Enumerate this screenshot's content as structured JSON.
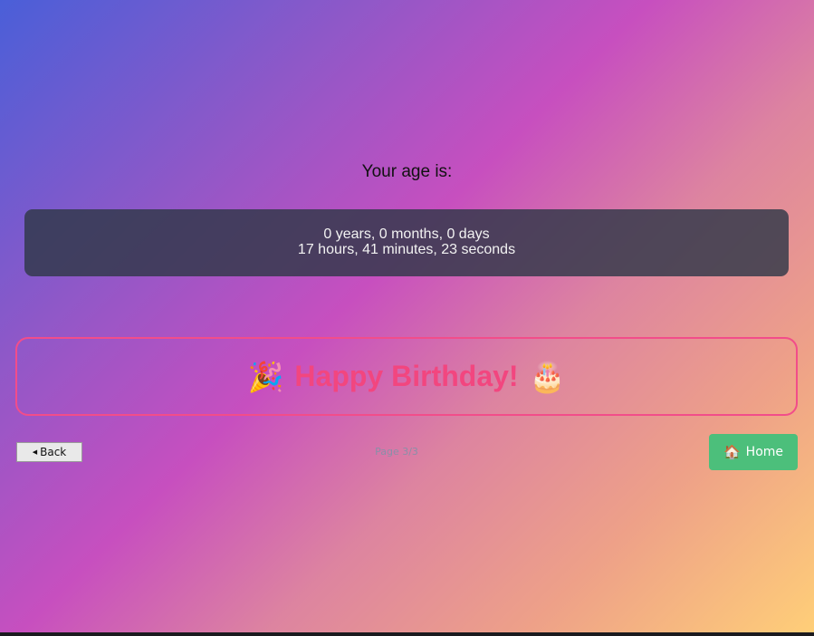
{
  "age": {
    "title": "Your age is:",
    "line1": "0 years, 0 months, 0 days",
    "line2": "17 hours, 41 minutes, 23 seconds"
  },
  "birthday": {
    "emoji_left": "🎉",
    "message": "Happy Birthday!",
    "emoji_right": "🎂"
  },
  "nav": {
    "back_icon": "◀",
    "back_label": "Back",
    "page_indicator": "Page 3/3",
    "home_icon": "🏠",
    "home_label": "Home"
  },
  "colors": {
    "accent_pink": "#f2467f",
    "home_green": "#4cbf7b",
    "age_box": "#303848"
  }
}
